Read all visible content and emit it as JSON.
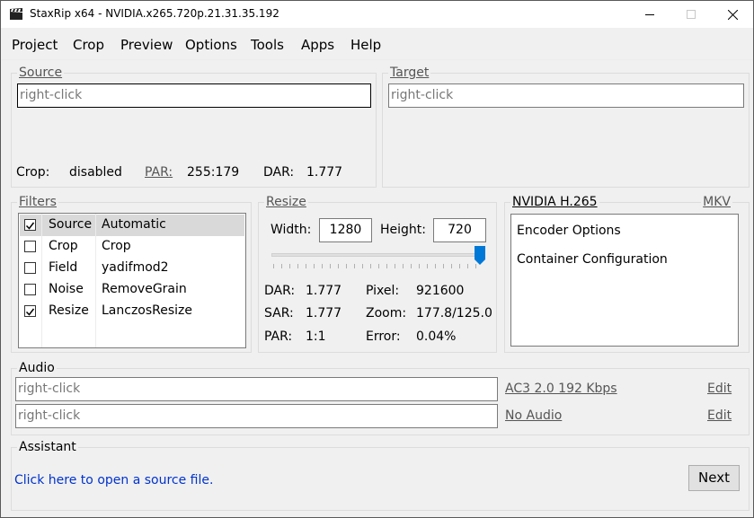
{
  "window": {
    "title": "StaxRip x64 - NVIDIA.x265.720p.21.31.35.192"
  },
  "menu": [
    "Project",
    "Crop",
    "Preview",
    "Options",
    "Tools",
    "Apps",
    "Help"
  ],
  "source": {
    "title": "Source",
    "placeholder": "right-click",
    "crop_label": "Crop:",
    "crop_value": "disabled",
    "par_label": "PAR:",
    "par_value": "255:179",
    "dar_label": "DAR:",
    "dar_value": "1.777"
  },
  "target": {
    "title": "Target",
    "placeholder": "right-click"
  },
  "filters": {
    "title": "Filters",
    "items": [
      {
        "checked": true,
        "name": "Source",
        "value": "Automatic"
      },
      {
        "checked": false,
        "name": "Crop",
        "value": "Crop"
      },
      {
        "checked": false,
        "name": "Field",
        "value": "yadifmod2"
      },
      {
        "checked": false,
        "name": "Noise",
        "value": "RemoveGrain"
      },
      {
        "checked": true,
        "name": "Resize",
        "value": "LanczosResize"
      }
    ]
  },
  "resize": {
    "title": "Resize",
    "width_label": "Width:",
    "width_value": "1280",
    "height_label": "Height:",
    "height_value": "720",
    "slider_level": 1.0,
    "dar_label": "DAR:",
    "dar_value": "1.777",
    "sar_label": "SAR:",
    "sar_value": "1.777",
    "par_label": "PAR:",
    "par_value": "1:1",
    "pixel_label": "Pixel:",
    "pixel_value": "921600",
    "zoom_label": "Zoom:",
    "zoom_value": "177.8/125.0",
    "error_label": "Error:",
    "error_value": "0.04%"
  },
  "encoder": {
    "title": "NVIDIA H.265",
    "container": "MKV",
    "items": [
      "Encoder Options",
      "Container Configuration"
    ]
  },
  "audio": {
    "title": "Audio",
    "tracks": [
      {
        "placeholder": "right-click",
        "profile": "AC3 2.0 192 Kbps",
        "edit": "Edit"
      },
      {
        "placeholder": "right-click",
        "profile": "No Audio",
        "edit": "Edit"
      }
    ]
  },
  "assistant": {
    "title": "Assistant",
    "message": "Click here to open a source file.",
    "next_label": "Next"
  },
  "colors": {
    "accent": "#0078d7",
    "link": "#0033cc",
    "background": "#f0f0f0"
  }
}
